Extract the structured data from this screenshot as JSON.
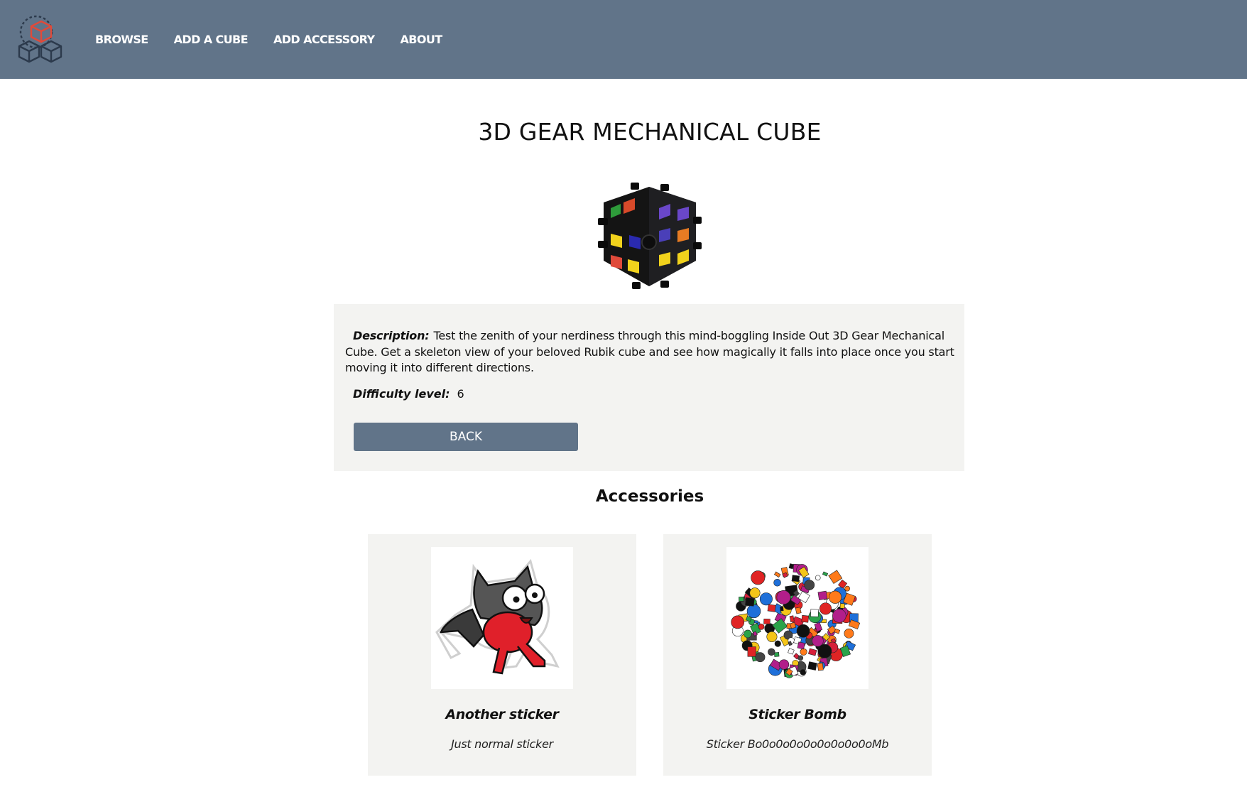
{
  "nav": {
    "logo_icon": "cube-stack-logo-icon",
    "items": [
      {
        "label": "BROWSE"
      },
      {
        "label": "ADD A CUBE"
      },
      {
        "label": "ADD ACCESSORY"
      },
      {
        "label": "ABOUT"
      }
    ]
  },
  "cube": {
    "title": "3D GEAR MECHANICAL CUBE",
    "image_icon": "gear-cube-image",
    "description_label": "Description:",
    "description": "Test the zenith of your nerdiness through this mind-boggling Inside Out 3D Gear Mechanical Cube. Get a skeleton view of your beloved Rubik cube and see how magically it falls into place once you start moving it into different directions.",
    "difficulty_label": "Difficulty level:",
    "difficulty": "6",
    "back_label": "BACK"
  },
  "accessories": {
    "heading": "Accessories",
    "items": [
      {
        "name": "Another sticker",
        "description": "Just normal sticker",
        "image_icon": "bat-cat-sticker-image"
      },
      {
        "name": "Sticker Bomb",
        "description": "Sticker Bo0o0o0o0o0o0o0o0oMb",
        "image_icon": "sticker-bomb-image"
      }
    ]
  },
  "colors": {
    "header": "#617489",
    "panel": "#f3f3f1",
    "accent": "#e04a3a"
  }
}
